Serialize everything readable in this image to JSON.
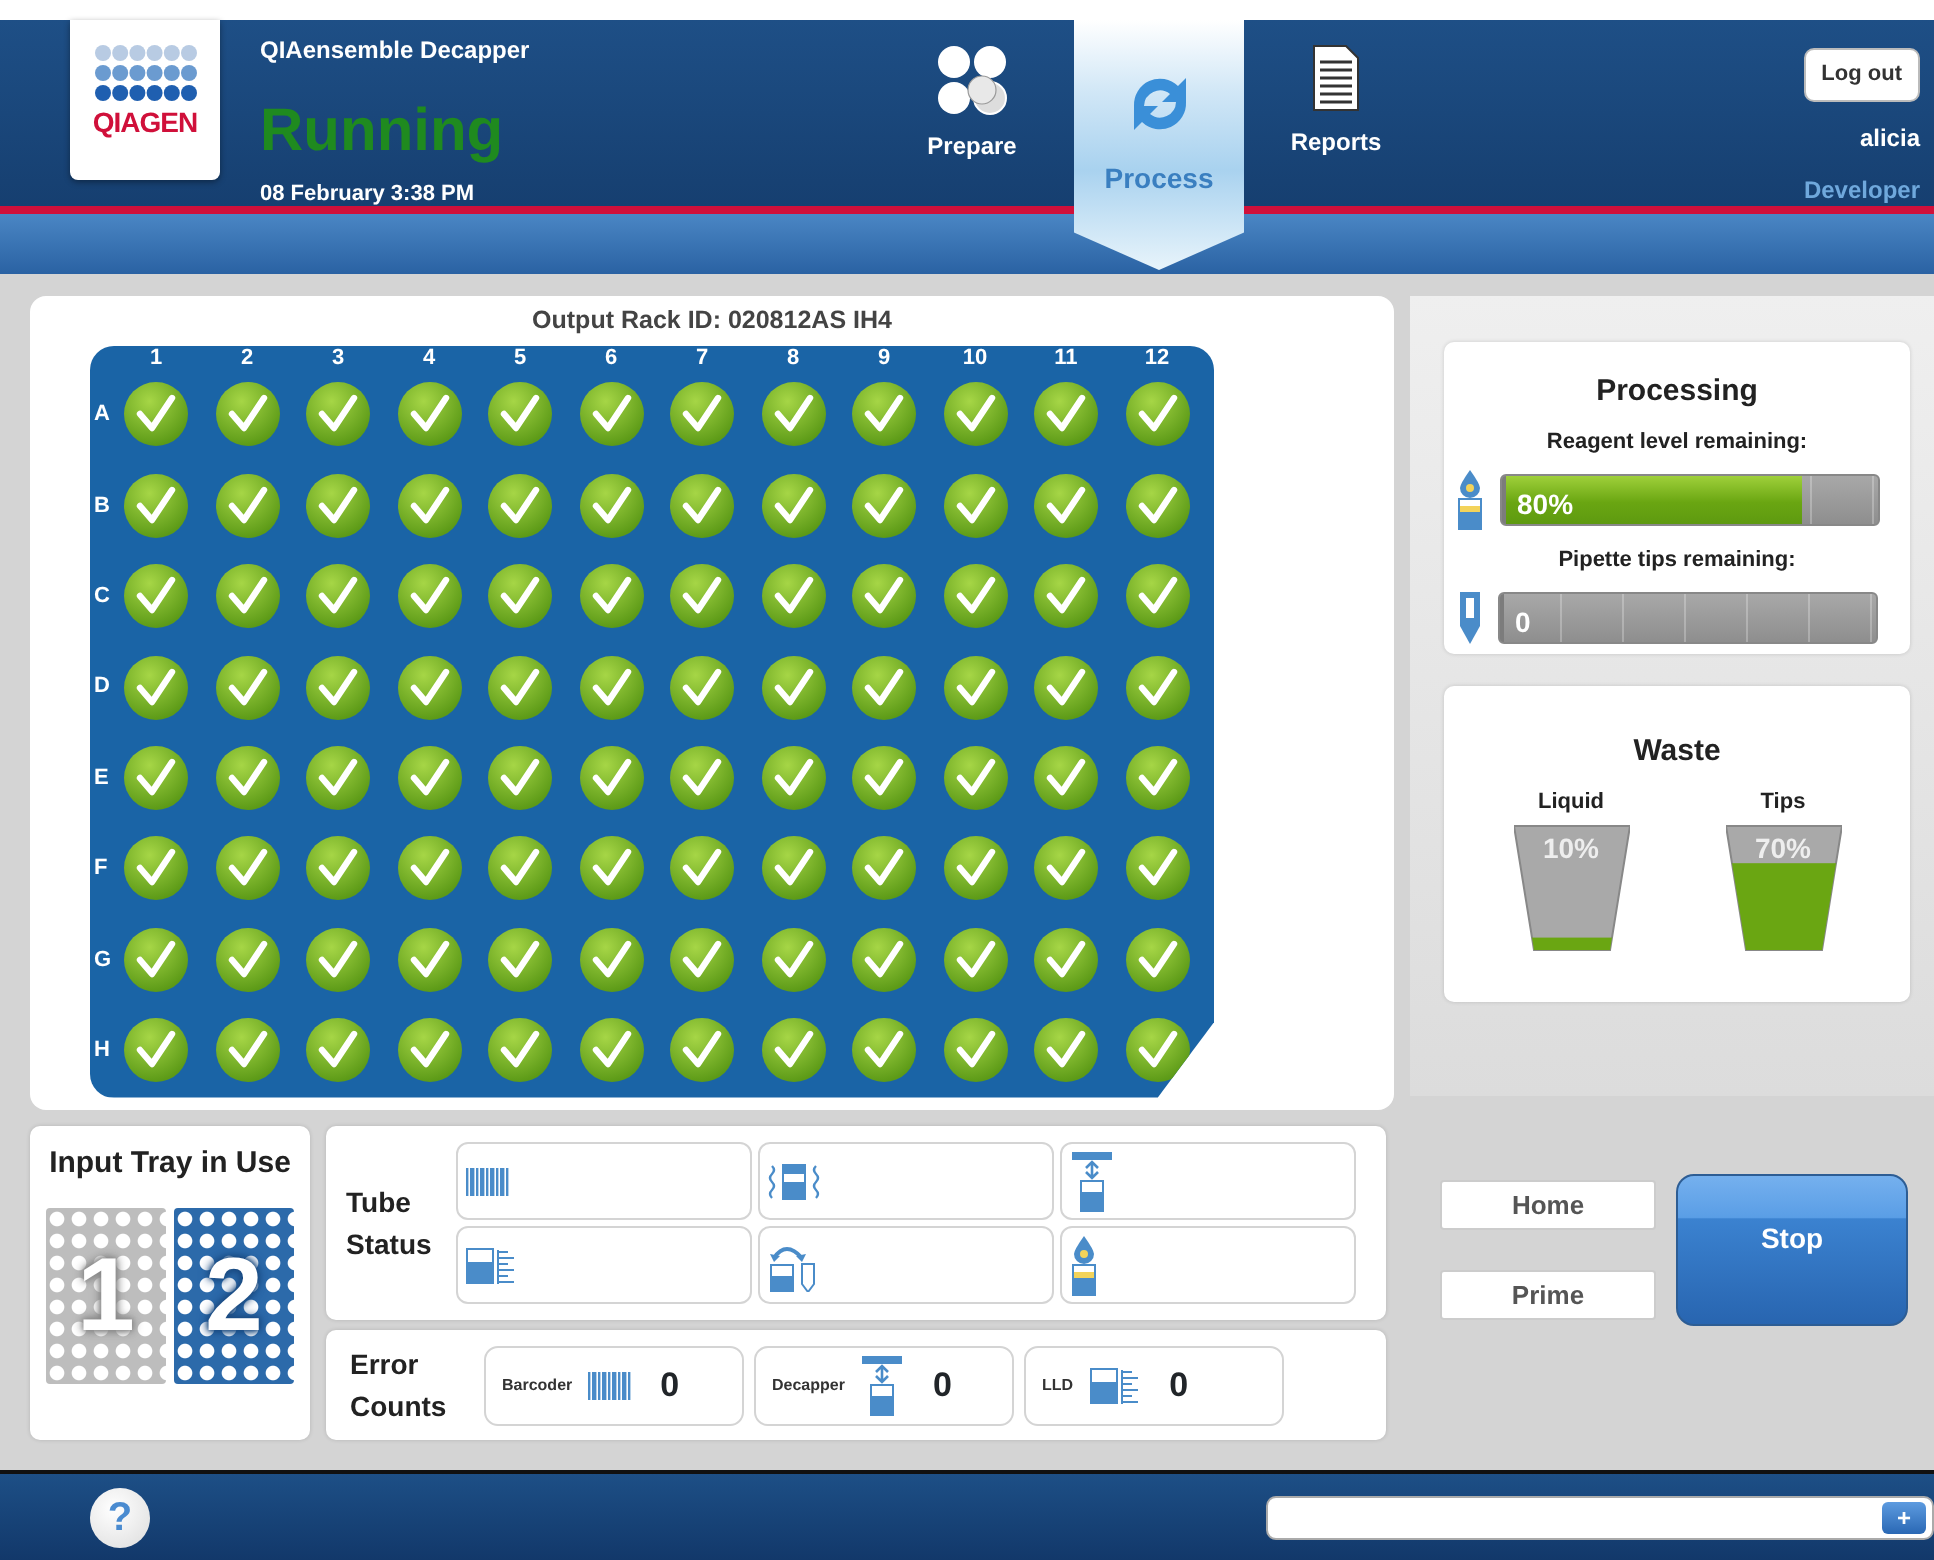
{
  "header": {
    "logo_text": "QIAGEN",
    "app_title": "QIAensemble Decapper",
    "status": "Running",
    "datetime": "08 February 3:38 PM",
    "logout_label": "Log out",
    "user": "alicia",
    "role": "Developer"
  },
  "nav": [
    {
      "label": "Prepare",
      "kind": "prepare",
      "selected": false
    },
    {
      "label": "Process",
      "kind": "process",
      "selected": true
    },
    {
      "label": "Reports",
      "kind": "reports",
      "selected": false
    }
  ],
  "plate": {
    "title": "Output Rack ID: 020812AS IH4",
    "columns": [
      "1",
      "2",
      "3",
      "4",
      "5",
      "6",
      "7",
      "8",
      "9",
      "10",
      "11",
      "12"
    ],
    "rows": [
      {
        "label": "A",
        "wells": [
          {
            "checked": true
          },
          {
            "checked": true
          },
          {
            "checked": true
          },
          {
            "checked": true
          },
          {
            "checked": true
          },
          {
            "checked": true
          },
          {
            "checked": true
          },
          {
            "checked": true
          },
          {
            "checked": true
          },
          {
            "checked": true
          },
          {
            "checked": true
          },
          {
            "checked": true
          }
        ]
      },
      {
        "label": "B",
        "wells": [
          {
            "checked": true
          },
          {
            "checked": true
          },
          {
            "checked": true
          },
          {
            "checked": true
          },
          {
            "checked": true
          },
          {
            "checked": true
          },
          {
            "checked": true
          },
          {
            "checked": true
          },
          {
            "checked": true
          },
          {
            "checked": true
          },
          {
            "checked": true
          },
          {
            "checked": true
          }
        ]
      },
      {
        "label": "C",
        "wells": [
          {
            "checked": true
          },
          {
            "checked": true
          },
          {
            "checked": true
          },
          {
            "checked": true
          },
          {
            "checked": true
          },
          {
            "checked": true
          },
          {
            "checked": true
          },
          {
            "checked": true
          },
          {
            "checked": true
          },
          {
            "checked": true
          },
          {
            "checked": true
          },
          {
            "checked": true
          }
        ]
      },
      {
        "label": "D",
        "wells": [
          {
            "checked": true
          },
          {
            "checked": true
          },
          {
            "checked": true
          },
          {
            "checked": true
          },
          {
            "checked": true
          },
          {
            "checked": true
          },
          {
            "checked": true
          },
          {
            "checked": true
          },
          {
            "checked": true
          },
          {
            "checked": true
          },
          {
            "checked": true
          },
          {
            "checked": true
          }
        ]
      },
      {
        "label": "E",
        "wells": [
          {
            "checked": true
          },
          {
            "checked": true
          },
          {
            "checked": true
          },
          {
            "checked": true
          },
          {
            "checked": true
          },
          {
            "checked": true
          },
          {
            "checked": true
          },
          {
            "checked": true
          },
          {
            "checked": true
          },
          {
            "checked": true
          },
          {
            "checked": true
          },
          {
            "checked": true
          }
        ]
      },
      {
        "label": "F",
        "wells": [
          {
            "checked": true
          },
          {
            "checked": true
          },
          {
            "checked": true
          },
          {
            "checked": true
          },
          {
            "checked": true
          },
          {
            "checked": true
          },
          {
            "checked": true
          },
          {
            "checked": true
          },
          {
            "checked": true
          },
          {
            "checked": true
          },
          {
            "checked": true
          },
          {
            "checked": true
          }
        ]
      },
      {
        "label": "G",
        "wells": [
          {
            "checked": true
          },
          {
            "checked": true
          },
          {
            "checked": true
          },
          {
            "checked": true
          },
          {
            "checked": true
          },
          {
            "checked": true
          },
          {
            "checked": true
          },
          {
            "checked": true
          },
          {
            "checked": true
          },
          {
            "checked": true
          },
          {
            "checked": true
          },
          {
            "checked": true
          }
        ]
      },
      {
        "label": "H",
        "wells": [
          {
            "checked": true
          },
          {
            "checked": true
          },
          {
            "checked": true
          },
          {
            "checked": true
          },
          {
            "checked": true
          },
          {
            "checked": true
          },
          {
            "checked": true
          },
          {
            "checked": true
          },
          {
            "checked": true
          },
          {
            "checked": true
          },
          {
            "checked": true
          },
          {
            "checked": true
          }
        ]
      }
    ]
  },
  "processing": {
    "title": "Processing",
    "meters": [
      {
        "label": "Reagent level remaining:",
        "kind": "reagent",
        "level": 0.8,
        "reading": "80%"
      },
      {
        "label": "Pipette tips remaining:",
        "kind": "tip",
        "level": 0,
        "reading": "0"
      }
    ]
  },
  "waste": {
    "title": "Waste",
    "bins": [
      {
        "label": "Liquid",
        "level": 0.1,
        "reading": "10%"
      },
      {
        "label": "Tips",
        "level": 0.7,
        "reading": "70%"
      }
    ]
  },
  "input_tray": {
    "title": "Input Tray in Use",
    "trays": [
      {
        "label": "1",
        "selected": false
      },
      {
        "label": "2",
        "selected": true
      }
    ]
  },
  "tube_status": {
    "title": "Tube Status",
    "cells": [
      {
        "kind": "barcode"
      },
      {
        "kind": "shake"
      },
      {
        "kind": "decapper"
      },
      {
        "kind": "lld"
      },
      {
        "kind": "recap"
      },
      {
        "kind": "reagent"
      }
    ]
  },
  "error_counts": {
    "title": "Error Counts",
    "items": [
      {
        "label": "Barcoder",
        "kind": "barcode",
        "count": "0"
      },
      {
        "label": "Decapper",
        "kind": "decapper",
        "count": "0"
      },
      {
        "label": "LLD",
        "kind": "lld",
        "count": "0"
      }
    ]
  },
  "buttons": [
    {
      "label": "Home",
      "kind": "secondary"
    },
    {
      "label": "Prime",
      "kind": "secondary"
    },
    {
      "label": "Stop",
      "kind": "primary"
    }
  ],
  "footer": {
    "help_label": "?",
    "add_label": "+"
  }
}
